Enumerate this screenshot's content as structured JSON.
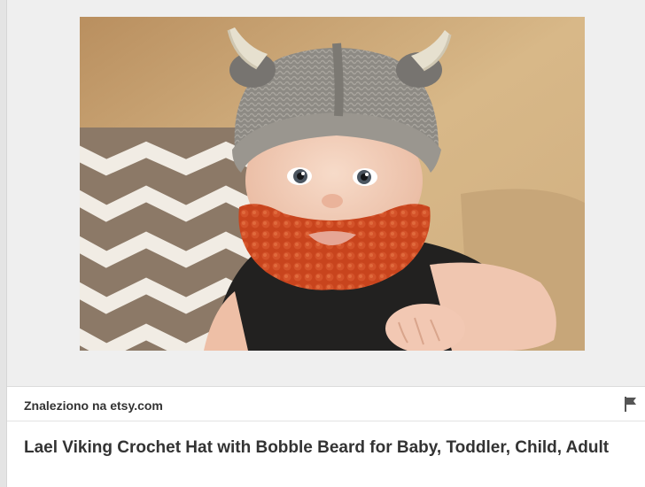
{
  "pin": {
    "image_alt": "Baby wearing a crocheted viking hat with horns and an orange bobble beard",
    "source_label": "Znaleziono na etsy.com",
    "title": "Lael Viking Crochet Hat with Bobble Beard for Baby, Toddler, Child, Adult"
  },
  "icons": {
    "report": "flag-icon"
  },
  "colors": {
    "text": "#333333",
    "page_background": "#efefef",
    "card_background": "#ffffff"
  }
}
